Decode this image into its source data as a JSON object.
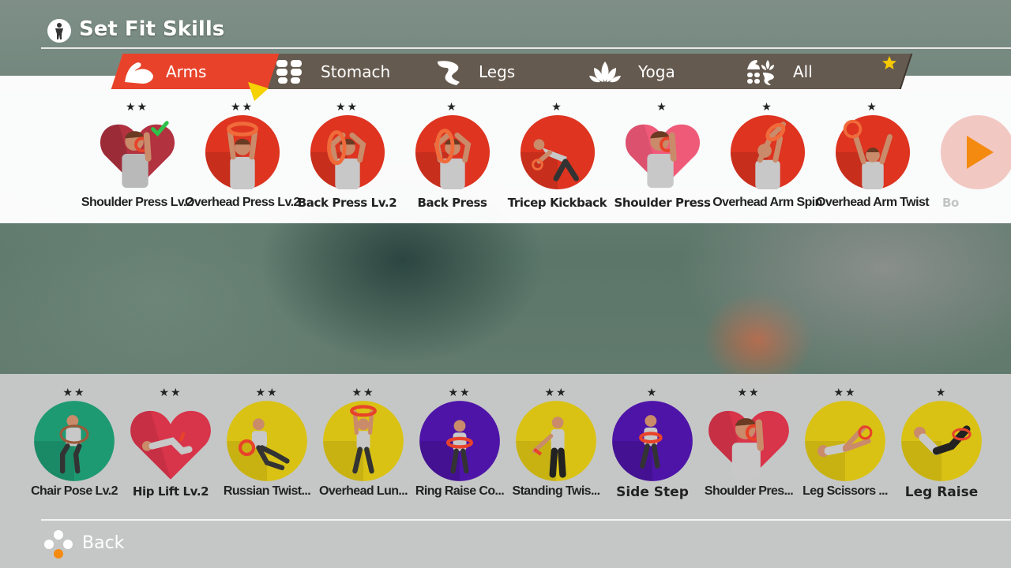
{
  "header": {
    "title": "Set Fit Skills",
    "icon": "person-icon"
  },
  "tabs": [
    {
      "label": "Arms",
      "icon": "flexed-arm-icon",
      "active": true
    },
    {
      "label": "Stomach",
      "icon": "abs-icon",
      "active": false
    },
    {
      "label": "Legs",
      "icon": "leg-icon",
      "active": false
    },
    {
      "label": "Yoga",
      "icon": "lotus-icon",
      "active": false
    },
    {
      "label": "All",
      "icon": "all-categories-icon",
      "active": false
    }
  ],
  "skills": [
    {
      "name": "Shoulder Press Lv.2",
      "stars": "★★",
      "shape": "heart",
      "color": "#b23240",
      "selected": true
    },
    {
      "name": "Overhead Press Lv.2",
      "stars": "★★",
      "shape": "circle",
      "color": "#de3420"
    },
    {
      "name": "Back Press Lv.2",
      "stars": "★★",
      "shape": "circle",
      "color": "#de3420"
    },
    {
      "name": "Back Press",
      "stars": "★",
      "shape": "circle",
      "color": "#de3420"
    },
    {
      "name": "Tricep Kickback",
      "stars": "★",
      "shape": "circle",
      "color": "#de3420"
    },
    {
      "name": "Shoulder Press",
      "stars": "★",
      "shape": "heart",
      "color": "#ef5a78"
    },
    {
      "name": "Overhead Arm Spin",
      "stars": "★",
      "shape": "circle",
      "color": "#de3420"
    },
    {
      "name": "Overhead Arm Twist",
      "stars": "★",
      "shape": "circle",
      "color": "#de3420"
    },
    {
      "name": "Bo",
      "stars": "",
      "shape": "circle",
      "color": "#de3420",
      "faded": true
    }
  ],
  "set_skills": [
    {
      "name": "Chair Pose Lv.2",
      "stars": "★★",
      "shape": "circle",
      "color": "#1e9a72"
    },
    {
      "name": "Hip Lift Lv.2",
      "stars": "★★",
      "shape": "heart",
      "color": "#d8344a"
    },
    {
      "name": "Russian Twist...",
      "stars": "★★",
      "shape": "circle",
      "color": "#d9c214"
    },
    {
      "name": "Overhead Lun...",
      "stars": "★★",
      "shape": "circle",
      "color": "#d9c214"
    },
    {
      "name": "Ring Raise Co...",
      "stars": "★★",
      "shape": "circle",
      "color": "#4e14a8"
    },
    {
      "name": "Standing Twis...",
      "stars": "★★",
      "shape": "circle",
      "color": "#d9c214"
    },
    {
      "name": "Side Step",
      "stars": "★",
      "shape": "circle",
      "color": "#4e14a8"
    },
    {
      "name": "Shoulder Pres...",
      "stars": "★★",
      "shape": "heart",
      "color": "#d8344a"
    },
    {
      "name": "Leg Scissors ...",
      "stars": "★★",
      "shape": "circle",
      "color": "#d9c214"
    },
    {
      "name": "Leg Raise",
      "stars": "★",
      "shape": "circle",
      "color": "#d9c214"
    }
  ],
  "footer": {
    "back_label": "Back",
    "back_icon": "controller-buttons-icon"
  },
  "colors": {
    "active_tab": "#e8432a",
    "tab": "#655a4f",
    "cursor": "#f5d200",
    "arrow": "#f58a10",
    "check": "#2ec24a"
  }
}
